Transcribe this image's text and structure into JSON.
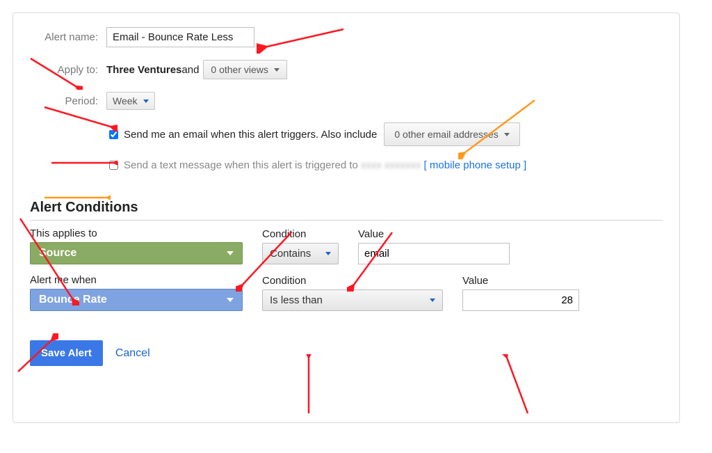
{
  "labels": {
    "alertName": "Alert name:",
    "applyTo": "Apply to:",
    "period": "Period:",
    "and": " and ",
    "sendEmail": "Send me an email when this alert triggers. Also include",
    "sendText": "Send a text message when this alert is triggered to",
    "mobileSetup": "[ mobile phone setup ]",
    "alertConditions": "Alert Conditions",
    "thisAppliesTo": "This applies to",
    "condition": "Condition",
    "value": "Value",
    "alertMeWhen": "Alert me when",
    "cancel": "Cancel"
  },
  "values": {
    "alertName": "Email - Bounce Rate Less",
    "applyToView": "Three Ventures",
    "otherViews": "0 other views",
    "period": "Week",
    "sendEmailChecked": true,
    "otherEmails": "0 other email addresses",
    "sendTextChecked": false,
    "obscuredPhone": "xxxx xxxxxxx",
    "appliesTo": "Source",
    "appliesCondition": "Contains",
    "appliesValue": "email",
    "alertMetric": "Bounce Rate",
    "alertCondition": "Is less than",
    "alertValue": "28"
  },
  "buttons": {
    "saveAlert": "Save Alert"
  }
}
